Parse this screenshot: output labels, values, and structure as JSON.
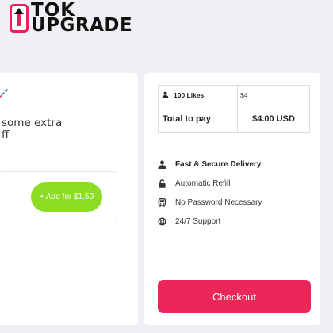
{
  "brand": {
    "line1": "TOK",
    "line2": "UPGRADE",
    "accent": "#e8215a"
  },
  "promo": {
    "line1": "some extra",
    "line2": "ff"
  },
  "addon": {
    "button_label": "+ Add for $1.50",
    "color": "#8ddc24"
  },
  "order": {
    "item_label": "100 Likes",
    "item_price": "$4",
    "total_label": "Total to pay",
    "total_value": "$4.00 USD"
  },
  "features": [
    {
      "label": "Fast & Secure Delivery",
      "icon": "user-icon"
    },
    {
      "label": "Automatic Refill",
      "icon": "unlock-icon"
    },
    {
      "label": "No Password Necessary",
      "icon": "bus-icon"
    },
    {
      "label": "24/7 Support",
      "icon": "lifering-icon"
    }
  ],
  "checkout": {
    "label": "Checkout",
    "color": "#eb2659"
  }
}
